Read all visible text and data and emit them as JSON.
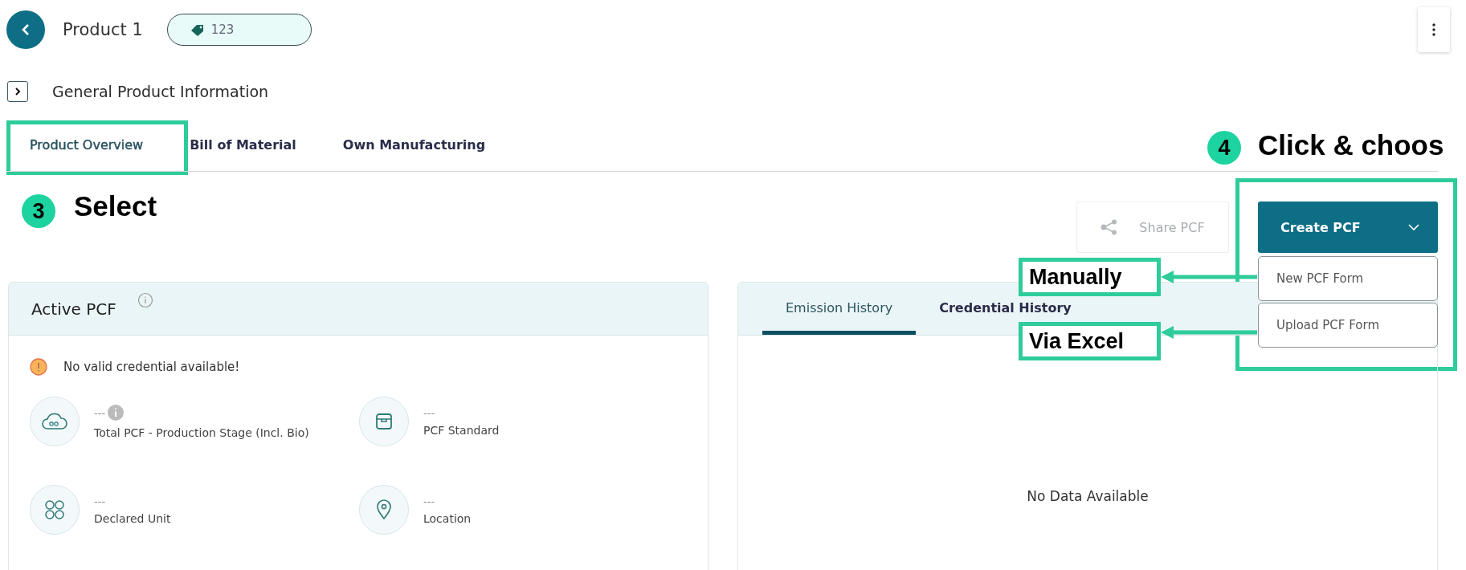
{
  "header": {
    "title": "Product 1",
    "tag": "123"
  },
  "section": {
    "title": "General Product Information",
    "expanded": false
  },
  "tabs": [
    {
      "label": "Product Overview",
      "selected": true
    },
    {
      "label": "Bill of Material",
      "selected": false
    },
    {
      "label": "Own Manufacturing",
      "selected": false
    }
  ],
  "actions": {
    "share": {
      "label": "Share PCF",
      "disabled": true
    },
    "create": {
      "label": "Create PCF",
      "menu": [
        {
          "label": "New PCF Form"
        },
        {
          "label": "Upload PCF Form"
        }
      ]
    }
  },
  "active_pcf": {
    "title": "Active PCF",
    "warning": "No valid credential available!",
    "fields": [
      {
        "kind": "co2",
        "value": "---",
        "label": "Total PCF - Production Stage (Incl. Bio)",
        "info": true
      },
      {
        "kind": "standard",
        "value": "---",
        "label": "PCF Standard",
        "info": false
      },
      {
        "kind": "unit",
        "value": "---",
        "label": "Declared Unit",
        "info": false
      },
      {
        "kind": "location",
        "value": "---",
        "label": "Location",
        "info": false
      }
    ]
  },
  "history": {
    "tabs": [
      {
        "label": "Emission History",
        "selected": true
      },
      {
        "label": "Credential History",
        "selected": false
      }
    ],
    "empty": "No Data Available"
  },
  "annotations": [
    {
      "number": "3",
      "text": "Select"
    },
    {
      "number": "4",
      "text": "Click & choos"
    },
    {
      "text": "Manually"
    },
    {
      "text": "Via Excel"
    }
  ]
}
